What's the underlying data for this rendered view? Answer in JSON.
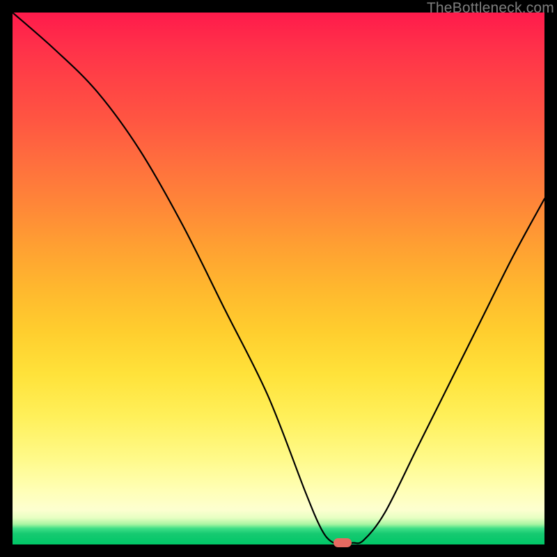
{
  "watermark": "TheBottleneck.com",
  "chart_data": {
    "type": "line",
    "title": "",
    "xlabel": "",
    "ylabel": "",
    "xlim": [
      0,
      100
    ],
    "ylim": [
      0,
      100
    ],
    "grid": false,
    "legend": false,
    "series": [
      {
        "name": "bottleneck-curve",
        "x": [
          0,
          8,
          16,
          24,
          32,
          40,
          48,
          55,
          58,
          60,
          62,
          64,
          66,
          70,
          76,
          82,
          88,
          94,
          100
        ],
        "values": [
          100,
          93,
          85,
          74,
          60,
          44,
          28,
          10,
          3,
          0.5,
          0.3,
          0.3,
          0.8,
          6,
          18,
          30,
          42,
          54,
          65
        ]
      }
    ],
    "marker": {
      "x": 62,
      "y": 0.3,
      "color": "#e66a61"
    },
    "annotations": []
  }
}
